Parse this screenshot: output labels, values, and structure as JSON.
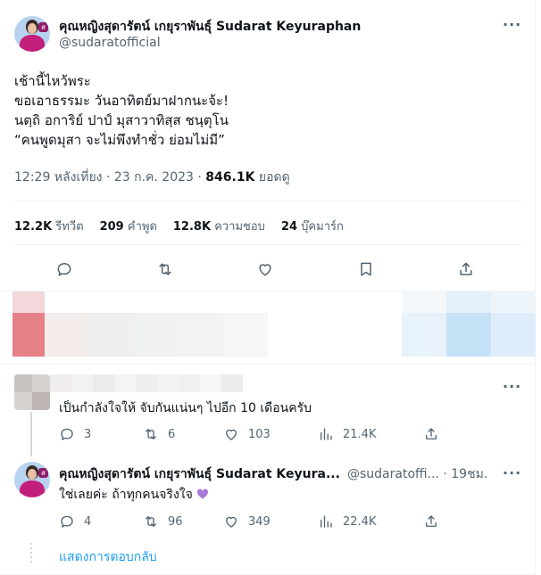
{
  "tweet": {
    "author_name": "คุณหญิงสุดารัตน์ เกยุราพันธุ์ Sudarat Keyuraphan",
    "author_handle": "@sudaratofficial",
    "lines": [
      "เช้านี้ไหว้พระ",
      "ขอเอาธรรมะ วันอาทิตย์มาฝากนะจ้ะ!",
      "นตฺถิ อการิย์ ปาป์ มุสาวาทิสฺส ชนฺตุโน",
      "“คนพูดมุสา จะไม่พึงทำชั่ว ย่อมไม่มี”"
    ],
    "time": "12:29 หลังเที่ยง · 23 ก.ค. 2023 · ",
    "views_value": "846.1K",
    "views_label": " ยอดดู"
  },
  "stats": [
    {
      "value": "12.2K",
      "label": "รีทวีต"
    },
    {
      "value": "209",
      "label": "คำพูด"
    },
    {
      "value": "12.8K",
      "label": "ความชอบ"
    },
    {
      "value": "24",
      "label": "บุ๊คมาร์ก"
    }
  ],
  "actions": [
    "reply-icon",
    "retweet-icon",
    "like-icon",
    "bookmark-icon",
    "share-icon"
  ],
  "reply1": {
    "text": "เป็นกำลังใจให้ จับกันแน่นๆ ไปอีก 10 เดือนครับ",
    "replies": "3",
    "retweets": "6",
    "likes": "103",
    "views": "21.4K"
  },
  "reply2": {
    "author_name": "คุณหญิงสุดารัตน์ เกยุราพันธุ์ Sudarat Keyura...",
    "author_handle": "@sudaratoffi...",
    "time": " · 19ชม.",
    "text": "ใช่เลยค่ะ ถ้าทุกคนจริงใจ",
    "heart_color": "#a879d6",
    "replies": "4",
    "retweets": "96",
    "likes": "349",
    "views": "22.4K"
  },
  "show_replies": "แสดงการตอบกลับ",
  "colors": {
    "accent": "#1d9bf0",
    "muted": "#536471",
    "text": "#0f1419",
    "avatar_pink": "#c21f7b"
  }
}
